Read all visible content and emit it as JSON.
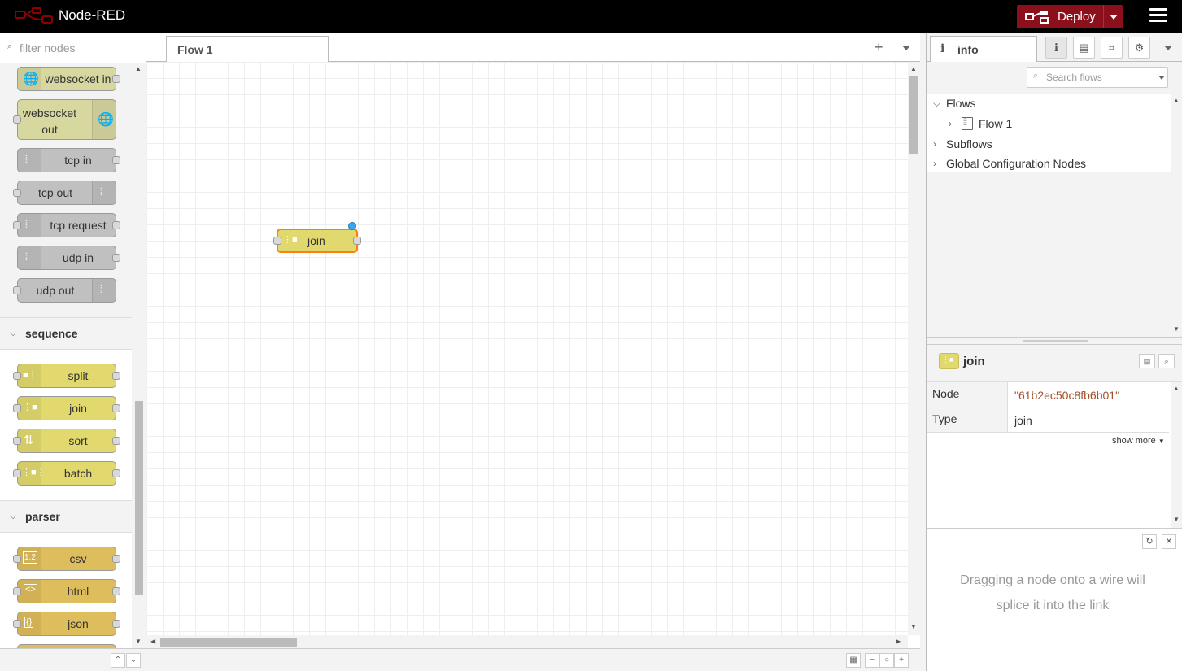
{
  "header": {
    "app_title": "Node-RED",
    "deploy_label": "Deploy",
    "colors": {
      "header_bg": "#000000",
      "deploy_bg": "#8c101c"
    }
  },
  "palette": {
    "search_placeholder": "filter nodes",
    "network_nodes": [
      {
        "label": "websocket in"
      },
      {
        "label": "websocket out"
      },
      {
        "label": "tcp in"
      },
      {
        "label": "tcp out"
      },
      {
        "label": "tcp request"
      },
      {
        "label": "udp in"
      },
      {
        "label": "udp out"
      }
    ],
    "categories": {
      "sequence": {
        "name": "sequence",
        "nodes": [
          {
            "label": "split"
          },
          {
            "label": "join"
          },
          {
            "label": "sort"
          },
          {
            "label": "batch"
          }
        ]
      },
      "parser": {
        "name": "parser",
        "nodes": [
          {
            "label": "csv"
          },
          {
            "label": "html"
          },
          {
            "label": "json"
          }
        ]
      }
    },
    "node_icons": {
      "websocket": "globe-icon",
      "tcp": "bridge-icon",
      "split": "split-icon",
      "join": "join-icon",
      "sort": "sort-icon",
      "batch": "batch-icon",
      "csv": "csv-icon",
      "html": "html-icon",
      "json": "json-icon"
    }
  },
  "workspace": {
    "tabs": [
      {
        "label": "Flow 1"
      }
    ],
    "canvas_node": {
      "label": "join",
      "color": "#e2d96e",
      "selected_border": "#ff7f0e"
    }
  },
  "sidebar": {
    "active_tab": "info",
    "search_placeholder": "Search flows",
    "tree": {
      "flows": "Flows",
      "flow1": "Flow 1",
      "subflows": "Subflows",
      "global_config": "Global Configuration Nodes"
    },
    "node_info": {
      "title": "join",
      "rows": [
        {
          "key": "Node",
          "value": "\"61b2ec50c8fb6b01\""
        },
        {
          "key": "Type",
          "value": "join"
        }
      ],
      "show_more": "show more"
    },
    "tip": "Dragging a node onto a wire will splice it into the link"
  }
}
